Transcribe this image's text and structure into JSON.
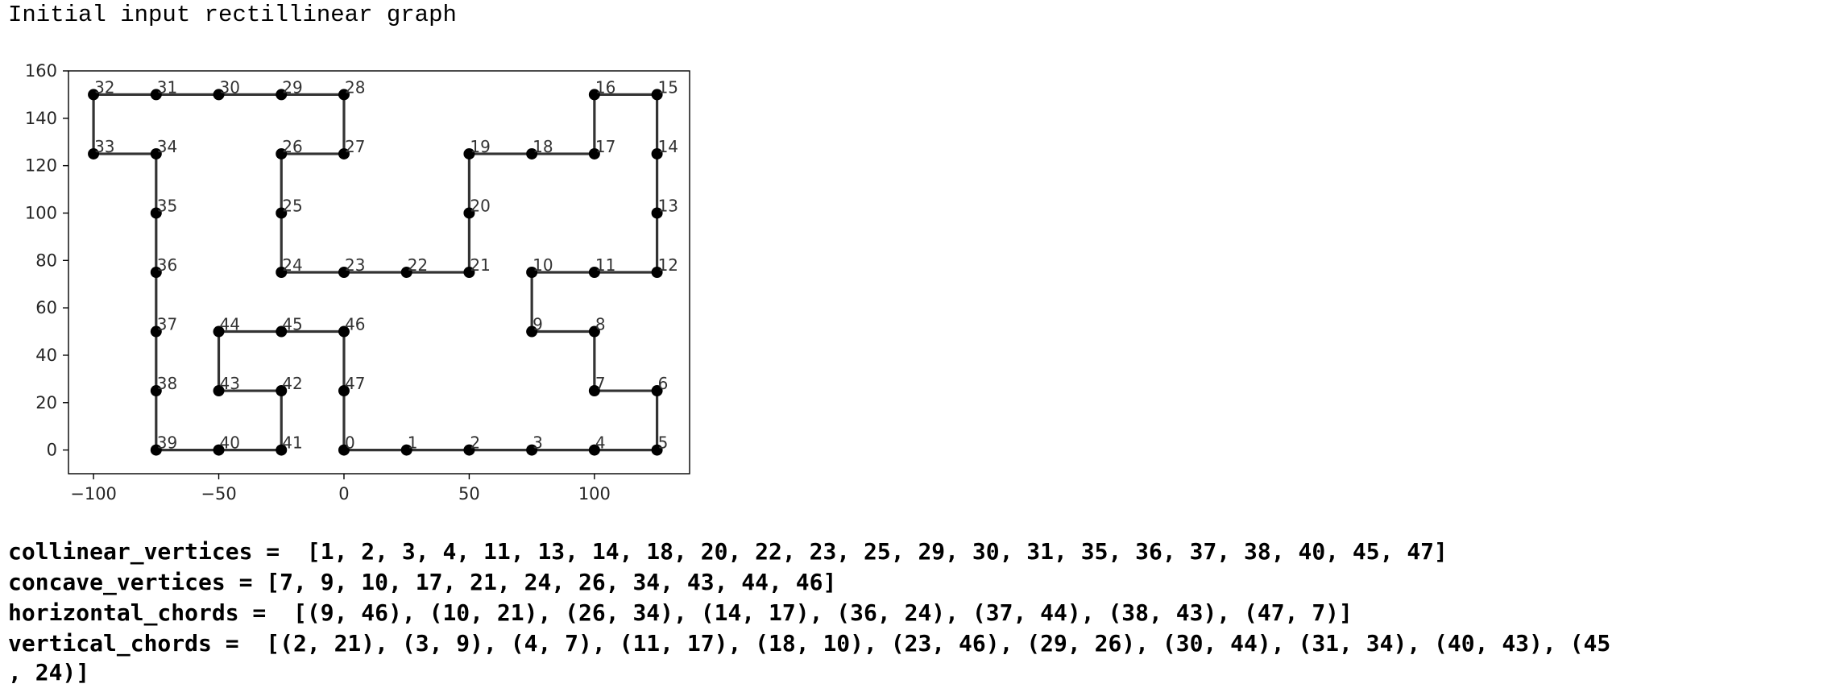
{
  "title": "Initial input rectillinear graph",
  "chart_data": {
    "type": "scatter",
    "title": "",
    "xlabel": "",
    "ylabel": "",
    "xlim": [
      -110,
      138
    ],
    "ylim": [
      -10,
      160
    ],
    "x_ticks": [
      -100,
      -50,
      0,
      50,
      100
    ],
    "y_ticks": [
      0,
      20,
      40,
      60,
      80,
      100,
      120,
      140,
      160
    ],
    "x_tick_labels": [
      "−100",
      "−50",
      "0",
      "50",
      "100"
    ],
    "y_tick_labels": [
      "0",
      "20",
      "40",
      "60",
      "80",
      "100",
      "120",
      "140",
      "160"
    ],
    "grid": false,
    "legend": "none",
    "color": "#000000",
    "vertices": [
      {
        "id": 0,
        "x": 0,
        "y": 0
      },
      {
        "id": 1,
        "x": 25,
        "y": 0
      },
      {
        "id": 2,
        "x": 50,
        "y": 0
      },
      {
        "id": 3,
        "x": 75,
        "y": 0
      },
      {
        "id": 4,
        "x": 100,
        "y": 0
      },
      {
        "id": 5,
        "x": 125,
        "y": 0
      },
      {
        "id": 6,
        "x": 125,
        "y": 25
      },
      {
        "id": 7,
        "x": 100,
        "y": 25
      },
      {
        "id": 8,
        "x": 100,
        "y": 50
      },
      {
        "id": 9,
        "x": 75,
        "y": 50
      },
      {
        "id": 10,
        "x": 75,
        "y": 75
      },
      {
        "id": 11,
        "x": 100,
        "y": 75
      },
      {
        "id": 12,
        "x": 125,
        "y": 75
      },
      {
        "id": 13,
        "x": 125,
        "y": 100
      },
      {
        "id": 14,
        "x": 125,
        "y": 125
      },
      {
        "id": 15,
        "x": 125,
        "y": 150
      },
      {
        "id": 16,
        "x": 100,
        "y": 150
      },
      {
        "id": 17,
        "x": 100,
        "y": 125
      },
      {
        "id": 18,
        "x": 75,
        "y": 125
      },
      {
        "id": 19,
        "x": 50,
        "y": 125
      },
      {
        "id": 20,
        "x": 50,
        "y": 100
      },
      {
        "id": 21,
        "x": 50,
        "y": 75
      },
      {
        "id": 22,
        "x": 25,
        "y": 75
      },
      {
        "id": 23,
        "x": 0,
        "y": 75
      },
      {
        "id": 24,
        "x": -25,
        "y": 75
      },
      {
        "id": 25,
        "x": -25,
        "y": 100
      },
      {
        "id": 26,
        "x": -25,
        "y": 125
      },
      {
        "id": 27,
        "x": 0,
        "y": 125
      },
      {
        "id": 28,
        "x": 0,
        "y": 150
      },
      {
        "id": 29,
        "x": -25,
        "y": 150
      },
      {
        "id": 30,
        "x": -50,
        "y": 150
      },
      {
        "id": 31,
        "x": -75,
        "y": 150
      },
      {
        "id": 32,
        "x": -100,
        "y": 150
      },
      {
        "id": 33,
        "x": -100,
        "y": 125
      },
      {
        "id": 34,
        "x": -75,
        "y": 125
      },
      {
        "id": 35,
        "x": -75,
        "y": 100
      },
      {
        "id": 36,
        "x": -75,
        "y": 75
      },
      {
        "id": 37,
        "x": -75,
        "y": 50
      },
      {
        "id": 38,
        "x": -75,
        "y": 25
      },
      {
        "id": 39,
        "x": -75,
        "y": 0
      },
      {
        "id": 40,
        "x": -50,
        "y": 0
      },
      {
        "id": 41,
        "x": -25,
        "y": 0
      },
      {
        "id": 42,
        "x": -25,
        "y": 25
      },
      {
        "id": 43,
        "x": -50,
        "y": 25
      },
      {
        "id": 44,
        "x": -50,
        "y": 50
      },
      {
        "id": 45,
        "x": -25,
        "y": 50
      },
      {
        "id": 46,
        "x": 0,
        "y": 50
      },
      {
        "id": 47,
        "x": 0,
        "y": 25
      }
    ],
    "closed": true
  },
  "output": {
    "collinear": "collinear_vertices =  [1, 2, 3, 4, 11, 13, 14, 18, 20, 22, 23, 25, 29, 30, 31, 35, 36, 37, 38, 40, 45, 47]",
    "concave": "concave_vertices = [7, 9, 10, 17, 21, 24, 26, 34, 43, 44, 46]",
    "horizontal": "horizontal_chords =  [(9, 46), (10, 21), (26, 34), (14, 17), (36, 24), (37, 44), (38, 43), (47, 7)]",
    "vertical_1": "vertical_chords =  [(2, 21), (3, 9), (4, 7), (11, 17), (18, 10), (23, 46), (29, 26), (30, 44), (31, 34), (40, 43), (45",
    "vertical_2": ", 24)]"
  }
}
